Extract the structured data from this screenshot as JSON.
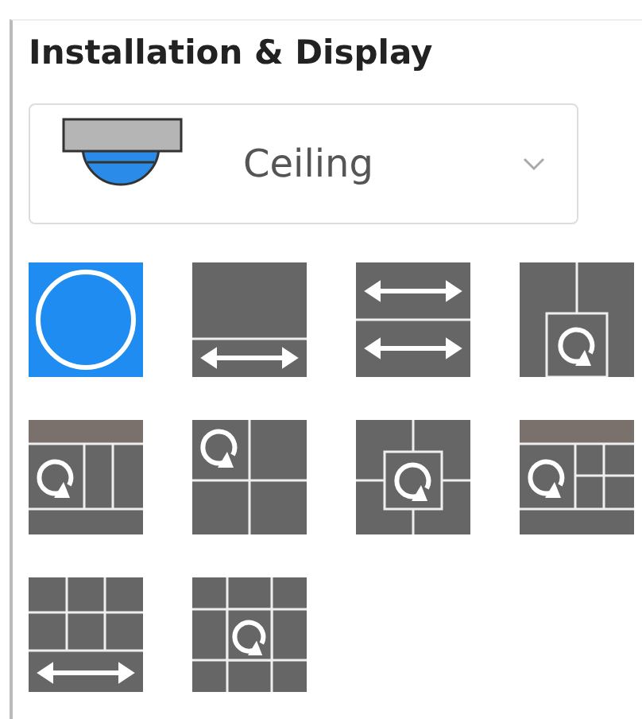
{
  "panel": {
    "title": "Installation & Display"
  },
  "mount": {
    "value": "Ceiling"
  },
  "display_modes": [
    {
      "kind": "fisheye",
      "selected": true
    },
    {
      "kind": "panorama",
      "selected": false
    },
    {
      "kind": "dualpanorama",
      "selected": false
    },
    {
      "kind": "ptzone",
      "selected": false
    },
    {
      "kind": "panoptzthree",
      "selected": false
    },
    {
      "kind": "quad",
      "selected": false
    },
    {
      "kind": "quadcenter",
      "selected": false
    },
    {
      "kind": "panoptzfive",
      "selected": false
    },
    {
      "kind": "ninepanorama",
      "selected": false
    },
    {
      "kind": "nine",
      "selected": false
    }
  ]
}
